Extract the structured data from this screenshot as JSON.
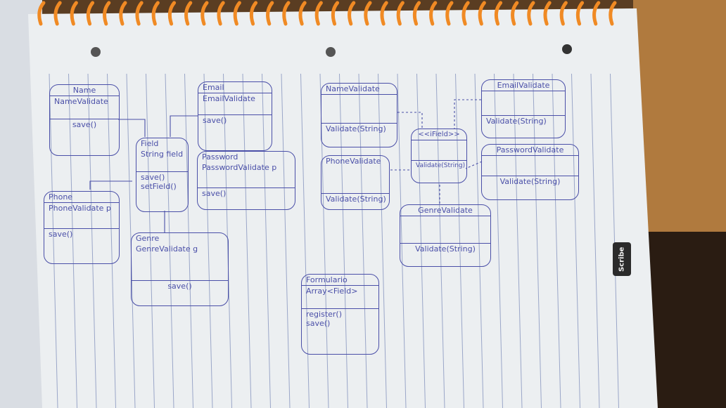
{
  "colors": {
    "ink": "#4a4fa8",
    "paper": "#eef0f2",
    "rule": "#9aa6c8",
    "spiral": "#f08a24",
    "desk": "#6b4e2e"
  },
  "brand": "Scribe",
  "boxes": [
    {
      "id": "name",
      "name": "Name",
      "attrs": [
        "NameValidate"
      ],
      "ops": [
        "save()"
      ]
    },
    {
      "id": "email",
      "name": "Email",
      "attrs": [
        "EmailValidate"
      ],
      "ops": [
        "save()"
      ]
    },
    {
      "id": "field",
      "name": "Field",
      "attrs": [
        "String field"
      ],
      "ops": [
        "save()",
        "setField()"
      ]
    },
    {
      "id": "password",
      "name": "Password",
      "attrs": [
        "PasswordValidate p"
      ],
      "ops": [
        "save()"
      ]
    },
    {
      "id": "phone",
      "name": "Phone",
      "attrs": [
        "PhoneValidate p"
      ],
      "ops": [
        "save()"
      ]
    },
    {
      "id": "genre",
      "name": "Genre",
      "attrs": [
        "GenreValidate g"
      ],
      "ops": [
        "save()"
      ]
    },
    {
      "id": "namevalidate",
      "name": "NameValidate",
      "attrs": [],
      "ops": [
        "Validate(String)"
      ]
    },
    {
      "id": "phonevalidate",
      "name": "PhoneValidate",
      "attrs": [],
      "ops": [
        "Validate(String)"
      ]
    },
    {
      "id": "ifield",
      "name": "<<iField>>",
      "attrs": [],
      "ops": [
        "Validate(String)"
      ]
    },
    {
      "id": "emailvalidate",
      "name": "EmailValidate",
      "attrs": [],
      "ops": [
        "Validate(String)"
      ]
    },
    {
      "id": "passwordvalidate",
      "name": "PasswordValidate",
      "attrs": [],
      "ops": [
        "Validate(String)"
      ]
    },
    {
      "id": "genrevalidate",
      "name": "GenreValidate",
      "attrs": [],
      "ops": [
        "Validate(String)"
      ]
    },
    {
      "id": "formulario",
      "name": "Formulario",
      "attrs": [
        "Array<Field>"
      ],
      "ops": [
        "register()",
        "save()"
      ]
    }
  ]
}
